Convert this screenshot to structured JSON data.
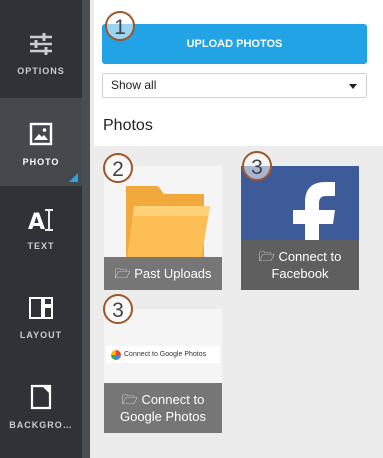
{
  "sidebar": {
    "items": [
      {
        "label": "OPTIONS",
        "icon": "sliders-icon"
      },
      {
        "label": "PHOTO",
        "icon": "image-icon"
      },
      {
        "label": "TEXT",
        "icon": "text-cursor-icon"
      },
      {
        "label": "LAYOUT",
        "icon": "layout-icon"
      },
      {
        "label": "BACKGRO…",
        "icon": "background-icon"
      }
    ]
  },
  "header": {
    "upload_label": "UPLOAD PHOTOS",
    "filter_value": "Show all",
    "section_title": "Photos"
  },
  "cards": {
    "past_uploads": "Past Uploads",
    "facebook_line1": "Connect to",
    "facebook_line2": "Facebook",
    "google_preview": "Connect to Google Photos",
    "google_line1": "Connect to",
    "google_line2": "Google Photos"
  },
  "annotations": {
    "badge1": "1",
    "badge2": "2",
    "badge3a": "3",
    "badge3b": "3"
  },
  "colors": {
    "accent": "#22a3e6",
    "sidebar": "#2f3236",
    "facebook": "#3d5b98",
    "badge_border": "#a0552a"
  }
}
